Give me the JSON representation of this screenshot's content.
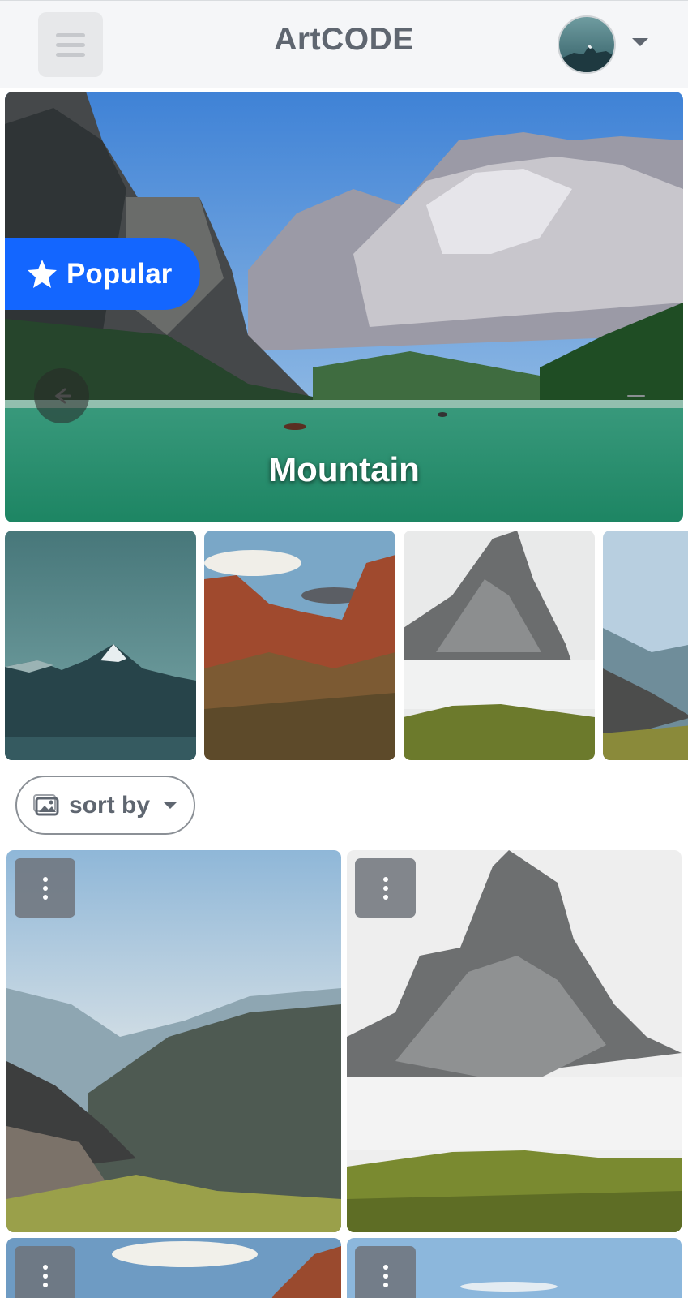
{
  "header": {
    "title": "ArtCODE",
    "menu_icon": "hamburger-menu-icon",
    "avatar_icon": "user-avatar",
    "dropdown_icon": "caret-down-icon"
  },
  "hero": {
    "badge_label": "Popular",
    "badge_icon": "star-icon",
    "caption": "Mountain",
    "prev_icon": "arrow-left-icon",
    "next_icon": "arrow-right-icon",
    "badge_color": "#1366ff"
  },
  "thumbnails": [
    {
      "name": "thumbnail-teal-peak"
    },
    {
      "name": "thumbnail-red-canyon"
    },
    {
      "name": "thumbnail-foggy-spire"
    },
    {
      "name": "thumbnail-valley-partial"
    }
  ],
  "sort": {
    "label": "sort by",
    "icon": "image-icon",
    "caret": "caret-down-icon"
  },
  "grid": {
    "more_icon": "more-vertical-icon"
  }
}
